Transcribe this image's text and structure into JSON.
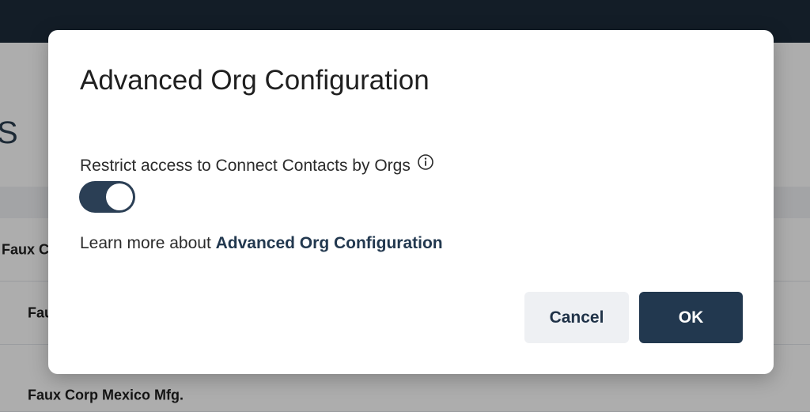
{
  "background": {
    "heading": "S",
    "rows": [
      {
        "name": "Faux C"
      },
      {
        "name": "Fau"
      },
      {
        "name": "Faux Corp Mexico Mfg."
      }
    ]
  },
  "modal": {
    "title": "Advanced Org Configuration",
    "setting_label": "Restrict access to Connect Contacts by Orgs",
    "toggle_on": true,
    "learn_more_prefix": "Learn more about ",
    "learn_more_link": "Advanced Org Configuration",
    "cancel_label": "Cancel",
    "ok_label": "OK"
  },
  "colors": {
    "primary": "#22384f",
    "topbar": "#1d2b3a",
    "cancel_bg": "#eef0f3"
  },
  "icons": {
    "info": "info-circle-icon"
  }
}
